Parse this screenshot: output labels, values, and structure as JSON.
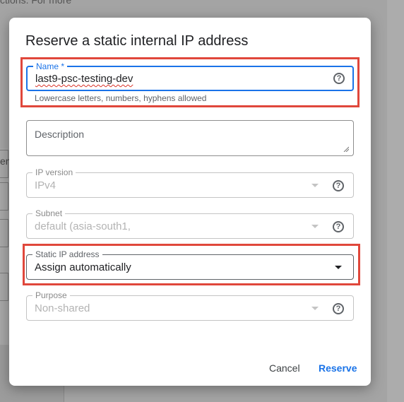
{
  "background": {
    "top_text": "ctions. For more",
    "field_fragment": "en"
  },
  "dialog": {
    "title": "Reserve a static internal IP address",
    "name_field": {
      "label": "Name *",
      "value": "last9-psc-testing-dev",
      "hint": "Lowercase letters, numbers, hyphens allowed",
      "help_icon": "help-circle-icon"
    },
    "description_field": {
      "placeholder": "Description"
    },
    "ip_version_field": {
      "label": "IP version",
      "value": "IPv4",
      "help_icon": "help-circle-icon"
    },
    "subnet_field": {
      "label": "Subnet",
      "value": "default (asia-south1,",
      "help_icon": "help-circle-icon"
    },
    "static_ip_field": {
      "label": "Static IP address",
      "value": "Assign automatically"
    },
    "purpose_field": {
      "label": "Purpose",
      "value": "Non-shared",
      "help_icon": "help-circle-icon"
    },
    "actions": {
      "cancel_label": "Cancel",
      "reserve_label": "Reserve"
    }
  },
  "colors": {
    "accent": "#1a73e8",
    "highlight": "#e0473b",
    "disabled_text": "#b3b3b3"
  }
}
